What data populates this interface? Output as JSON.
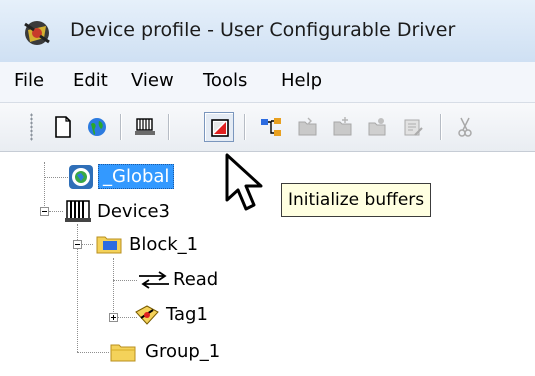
{
  "window": {
    "title": "Device profile - User Configurable Driver"
  },
  "menu": {
    "items": [
      {
        "label": "File"
      },
      {
        "label": "Edit"
      },
      {
        "label": "View"
      },
      {
        "label": "Tools"
      },
      {
        "label": "Help"
      }
    ]
  },
  "toolbar": {
    "buttons": [
      {
        "icon": "new-document-icon"
      },
      {
        "icon": "globe-icon"
      },
      {
        "icon": "device-icon"
      },
      {
        "icon": "initialize-buffers-icon",
        "state": "hovered"
      },
      {
        "icon": "tree-structure-icon"
      },
      {
        "icon": "add-block-icon",
        "state": "disabled"
      },
      {
        "icon": "add-block-icon",
        "state": "disabled"
      },
      {
        "icon": "add-tag-icon",
        "state": "disabled"
      },
      {
        "icon": "properties-icon",
        "state": "disabled"
      },
      {
        "icon": "cut-icon",
        "state": "disabled"
      }
    ]
  },
  "tree": {
    "nodes": [
      {
        "label": "_Global",
        "icon": "global-icon",
        "selected": true
      },
      {
        "label": "Device3",
        "icon": "device-icon",
        "expanded": true
      },
      {
        "label": "Block_1",
        "icon": "block-folder-icon",
        "expanded": true
      },
      {
        "label": "Read",
        "icon": "read-write-arrows-icon"
      },
      {
        "label": "Tag1",
        "icon": "tag-icon",
        "expanded": false
      },
      {
        "label": "Group_1",
        "icon": "group-folder-icon"
      }
    ]
  },
  "tooltip": {
    "text": "Initialize buffers"
  },
  "colors": {
    "selection": "#3399ff",
    "tooltip_bg": "#ffffe1",
    "titlebar": "#cfe0f3"
  }
}
